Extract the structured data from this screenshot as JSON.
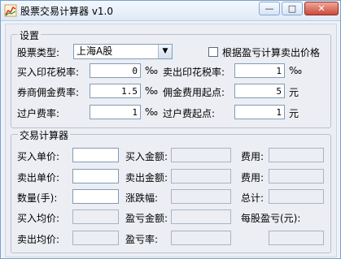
{
  "window": {
    "title": "股票交易计算器 v1.0",
    "min": "—",
    "max": "□",
    "close": "✕"
  },
  "settings": {
    "group_label": "设置",
    "stock_type_label": "股票类型:",
    "stock_type_value": "上海A股",
    "checkbox_label": "根据盈亏计算卖出价格",
    "checkbox_checked": false,
    "buy_stamp_label": "买入印花税率:",
    "buy_stamp_value": "0",
    "buy_stamp_unit": "‰",
    "sell_stamp_label": "卖出印花税率:",
    "sell_stamp_value": "1",
    "sell_stamp_unit": "‰",
    "commission_label": "券商佣金费率:",
    "commission_value": "1.5",
    "commission_unit": "‰",
    "commission_min_label": "佣金费用起点:",
    "commission_min_value": "5",
    "commission_min_unit": "元",
    "transfer_rate_label": "过户费率:",
    "transfer_rate_value": "1",
    "transfer_rate_unit": "‰",
    "transfer_min_label": "过户费起点:",
    "transfer_min_value": "1",
    "transfer_min_unit": "元"
  },
  "calculator": {
    "group_label": "交易计算器",
    "buy_price_label": "买入单价:",
    "buy_amount_label": "买入金额:",
    "fee1_label": "费用:",
    "sell_price_label": "卖出单价:",
    "sell_amount_label": "卖出金额:",
    "fee2_label": "费用:",
    "quantity_label": "数量(手):",
    "change_label": "涨跌幅:",
    "total_label": "总计:",
    "buy_avg_label": "买入均价:",
    "profit_amount_label": "盈亏金额:",
    "per_share_profit_label": "每股盈亏(元):",
    "sell_avg_label": "卖出均价:",
    "profit_rate_label": "盈亏率:"
  }
}
